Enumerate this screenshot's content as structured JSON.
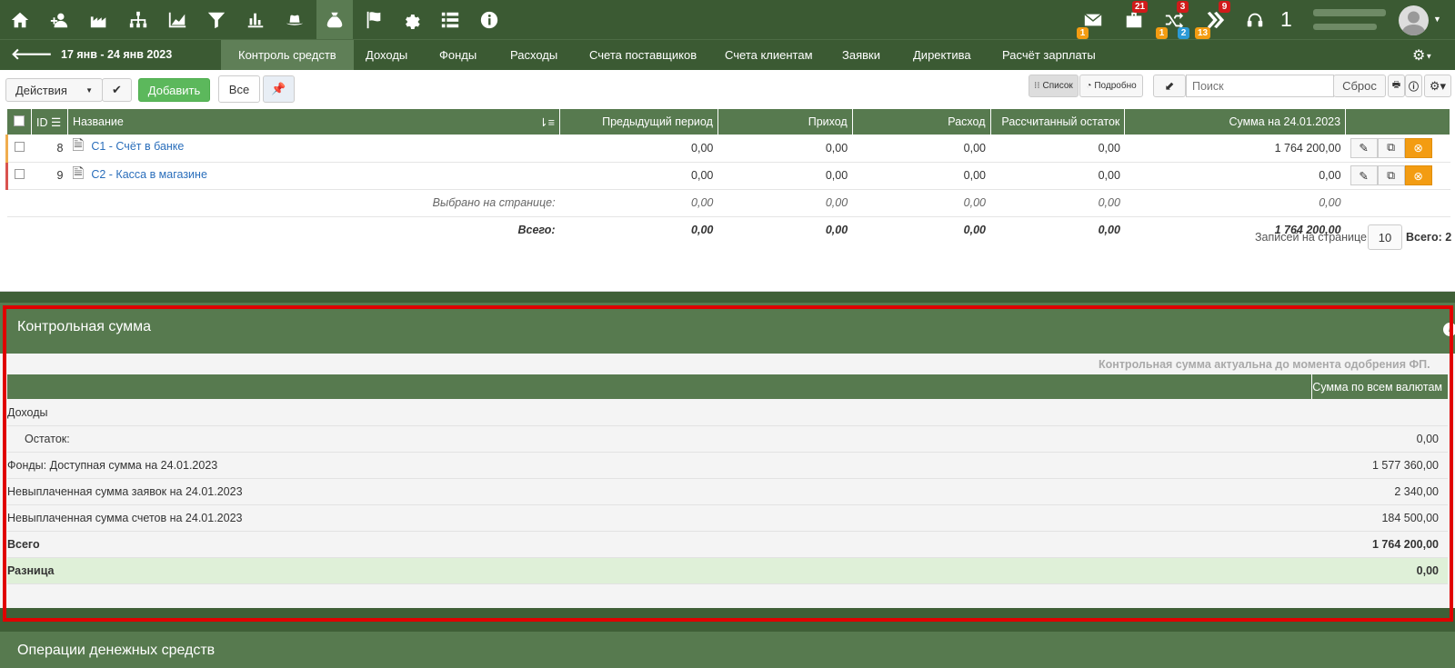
{
  "top_icons": [
    {
      "name": "home-icon",
      "glyph": "⌂"
    },
    {
      "name": "user-add-icon",
      "glyph": "👤"
    },
    {
      "name": "factory-icon",
      "glyph": "🏭"
    },
    {
      "name": "org-chart-icon",
      "glyph": "⊥"
    },
    {
      "name": "area-chart-icon",
      "glyph": "◢"
    },
    {
      "name": "filter-icon",
      "glyph": "▼"
    },
    {
      "name": "bar-chart-icon",
      "glyph": "▮"
    },
    {
      "name": "hat-icon",
      "glyph": "🎩"
    },
    {
      "name": "money-bag-icon",
      "glyph": "💰"
    },
    {
      "name": "flag-icon",
      "glyph": "⚑"
    },
    {
      "name": "gear-icon",
      "glyph": "⚙"
    },
    {
      "name": "list-icon",
      "glyph": "☰"
    },
    {
      "name": "info-icon",
      "glyph": "ℹ"
    }
  ],
  "notifications": {
    "mail_badge": "1",
    "briefcase_badge": "21",
    "shuffle_badge_top": "3",
    "shuffle_badge_1": "1",
    "shuffle_badge_2": "2",
    "shuffle_badge_3": "13",
    "forward_badge": "9",
    "counter": "1"
  },
  "nav": {
    "period": "17 янв - 24 янв 2023",
    "tabs": [
      "Контроль средств",
      "Доходы",
      "Фонды",
      "Расходы",
      "Счета поставщиков",
      "Счета клиентам",
      "Заявки",
      "Директива",
      "Расчёт зарплаты"
    ]
  },
  "toolbar": {
    "actions": "Действия",
    "add": "Добавить",
    "all": "Все",
    "view_list": "Список",
    "view_detail": "Подробно",
    "search_placeholder": "Поиск",
    "reset": "Сброс"
  },
  "table": {
    "headers": [
      "ID",
      "Название",
      "Предыдущий период",
      "Приход",
      "Расход",
      "Рассчитанный остаток",
      "Сумма на 24.01.2023"
    ],
    "rows": [
      {
        "id": "8",
        "name": "С1 - Счёт в банке",
        "prev": "0,00",
        "in": "0,00",
        "out": "0,00",
        "calc": "0,00",
        "sum": "1 764 200,00"
      },
      {
        "id": "9",
        "name": "С2 - Касса в магазине",
        "prev": "0,00",
        "in": "0,00",
        "out": "0,00",
        "calc": "0,00",
        "sum": "0,00"
      }
    ],
    "selected": {
      "label": "Выбрано на странице:",
      "prev": "0,00",
      "in": "0,00",
      "out": "0,00",
      "calc": "0,00",
      "sum": "0,00"
    },
    "total": {
      "label": "Всего:",
      "prev": "0,00",
      "in": "0,00",
      "out": "0,00",
      "calc": "0,00",
      "sum": "1 764 200,00"
    },
    "per_page_label": "Записей на странице",
    "per_page": "10",
    "total_count": "Всего: 2"
  },
  "control_sum": {
    "title": "Контрольная сумма",
    "note": "Контрольная сумма актуальна до момента одобрения ФП.",
    "col_header": "Сумма по всем валютам",
    "rows": [
      {
        "label": "Доходы",
        "value": ""
      },
      {
        "label": "Остаток:",
        "value": "0,00"
      },
      {
        "label": "Фонды: Доступная сумма на 24.01.2023",
        "value": "1 577 360,00"
      },
      {
        "label": "Невыплаченная сумма заявок на 24.01.2023",
        "value": "2 340,00"
      },
      {
        "label": "Невыплаченная сумма счетов на 24.01.2023",
        "value": "184 500,00"
      },
      {
        "label": "Всего",
        "value": "1 764 200,00"
      },
      {
        "label": "Разница",
        "value": "0,00"
      }
    ]
  },
  "operations_title": "Операции денежных средств",
  "colors": {
    "topbar": "#3b5a33",
    "header": "#577a4f",
    "accent_orange": "#f39c12",
    "highlight": "#e00000"
  }
}
